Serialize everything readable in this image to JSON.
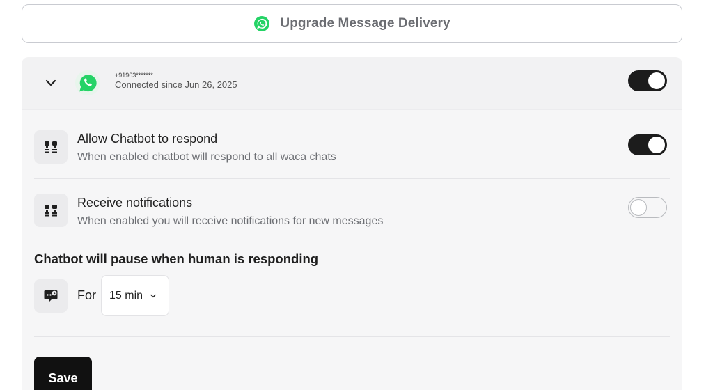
{
  "upgrade": {
    "label": "Upgrade Message Delivery",
    "icon": "whatsapp-icon"
  },
  "account": {
    "phone": "+91963*******",
    "connected": "Connected since Jun 26, 2025",
    "enabled": true,
    "icon": "whatsapp-icon"
  },
  "settings": [
    {
      "title": "Allow Chatbot to respond",
      "description": "When enabled chatbot will respond to all waca chats",
      "enabled": true,
      "icon": "chatbot-icon"
    },
    {
      "title": "Receive notifications",
      "description": "When enabled you will receive notifications for new messages",
      "enabled": false,
      "icon": "chatbot-icon"
    }
  ],
  "pause": {
    "title": "Chatbot will pause when human is responding",
    "for_label": "For",
    "duration": "15 min",
    "icon": "chat-clock-icon"
  },
  "actions": {
    "save_label": "Save"
  },
  "colors": {
    "whatsapp_green": "#25D366",
    "toggle_on": "#1c1c1c",
    "card_bg": "#f6f6f7"
  }
}
